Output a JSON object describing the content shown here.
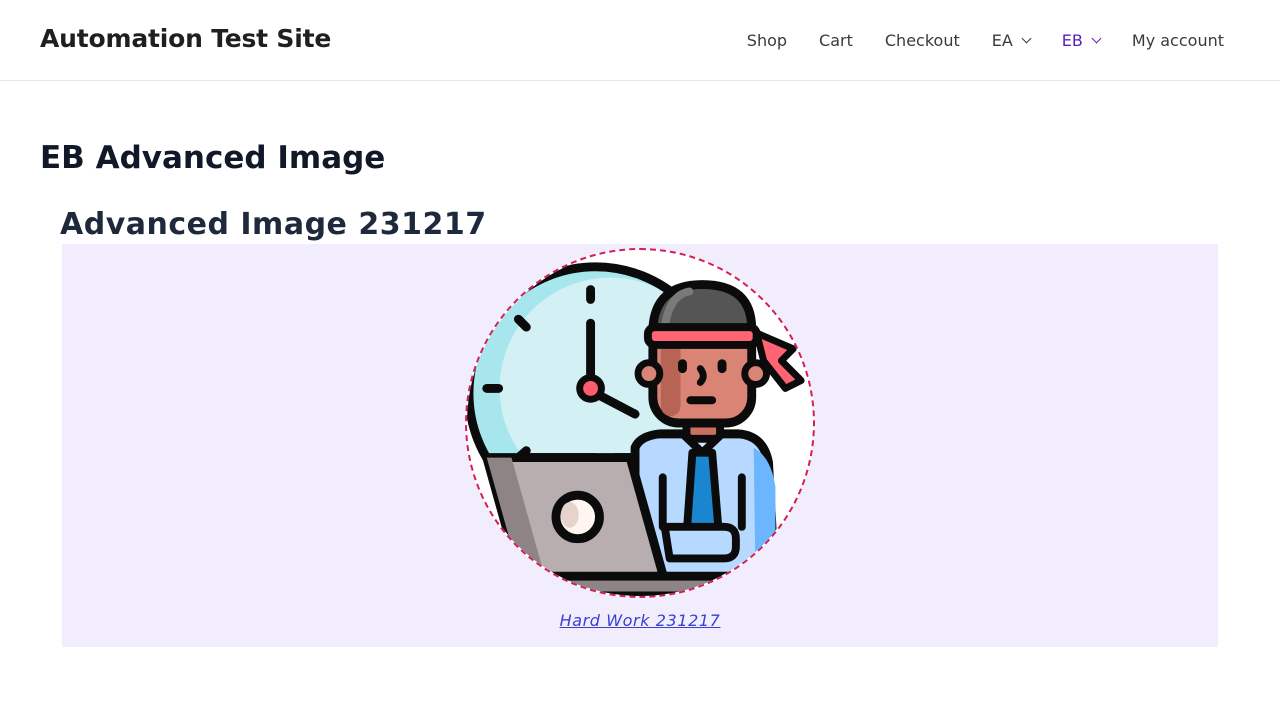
{
  "site": {
    "title": "Automation Test Site"
  },
  "nav": {
    "items": [
      {
        "label": "Shop"
      },
      {
        "label": "Cart"
      },
      {
        "label": "Checkout"
      },
      {
        "label": "EA"
      },
      {
        "label": "EB"
      },
      {
        "label": "My account"
      }
    ],
    "active_color": "#5b21b6"
  },
  "page": {
    "title": "EB Advanced Image"
  },
  "block": {
    "title": "Advanced Image 231217",
    "caption": "Hard Work 231217",
    "image_icon": "hard-work-illustration",
    "background_color": "#f1edfd",
    "border_color": "#d61d5a"
  }
}
